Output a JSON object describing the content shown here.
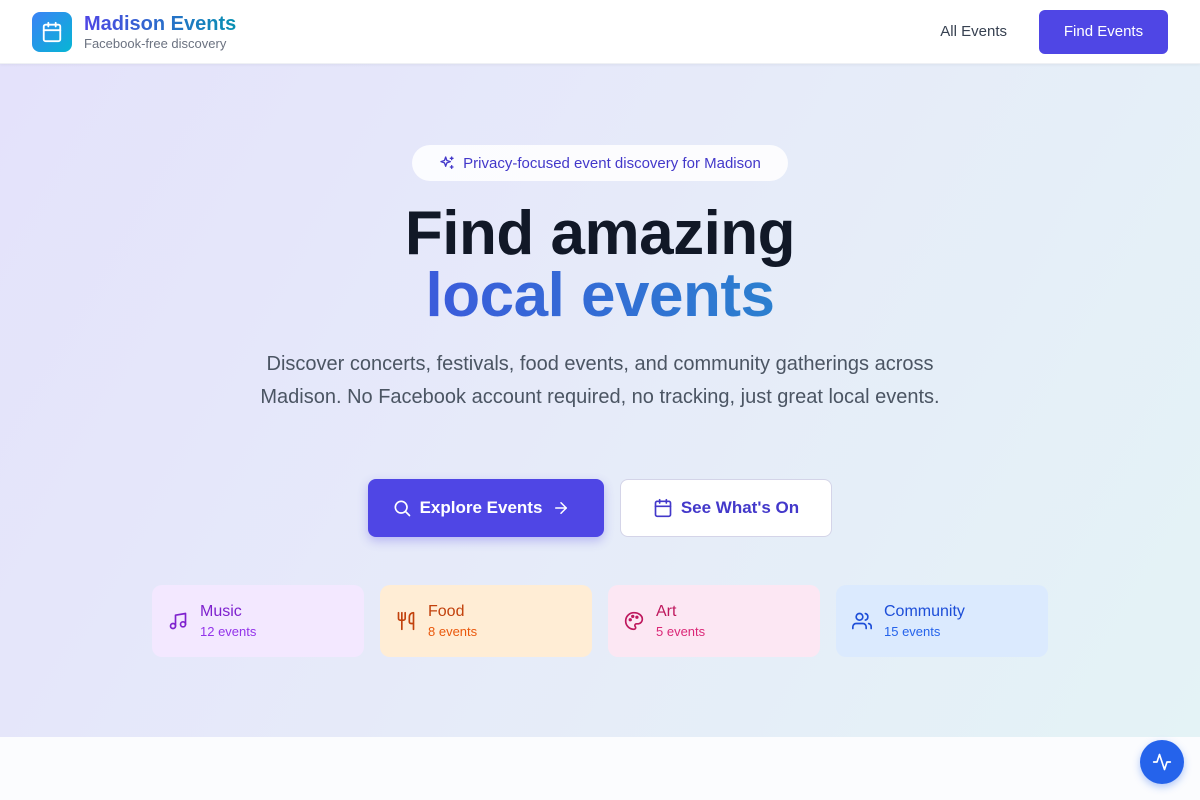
{
  "header": {
    "app_name": "Madison Events",
    "tagline": "Facebook-free discovery",
    "nav_all_events": "All Events",
    "nav_find_events": "Find Events"
  },
  "hero": {
    "badge": "Privacy-focused event discovery for Madison",
    "title_line1": "Find amazing",
    "title_line2": "local events",
    "lead": "Discover concerts, festivals, food events, and community gatherings across Madison. No Facebook account required, no tracking, just great local events.",
    "primary_button": "Explore Events",
    "secondary_button": "See What's On"
  },
  "categories": [
    {
      "name": "Music",
      "count": "12 events",
      "icon": "music-note-icon",
      "bg": "#f3e8ff",
      "color": "#7e22ce"
    },
    {
      "name": "Food",
      "count": "8 events",
      "icon": "utensils-icon",
      "bg": "#ffedd5",
      "color": "#c2410c"
    },
    {
      "name": "Art",
      "count": "5 events",
      "icon": "palette-icon",
      "bg": "#fce7f3",
      "color": "#be185d"
    },
    {
      "name": "Community",
      "count": "15 events",
      "icon": "users-icon",
      "bg": "#dbeafe",
      "color": "#1d4ed8"
    }
  ],
  "colors": {
    "accent": "#4f46e5",
    "fab": "#2563eb"
  },
  "fab_icon": "activity-icon"
}
